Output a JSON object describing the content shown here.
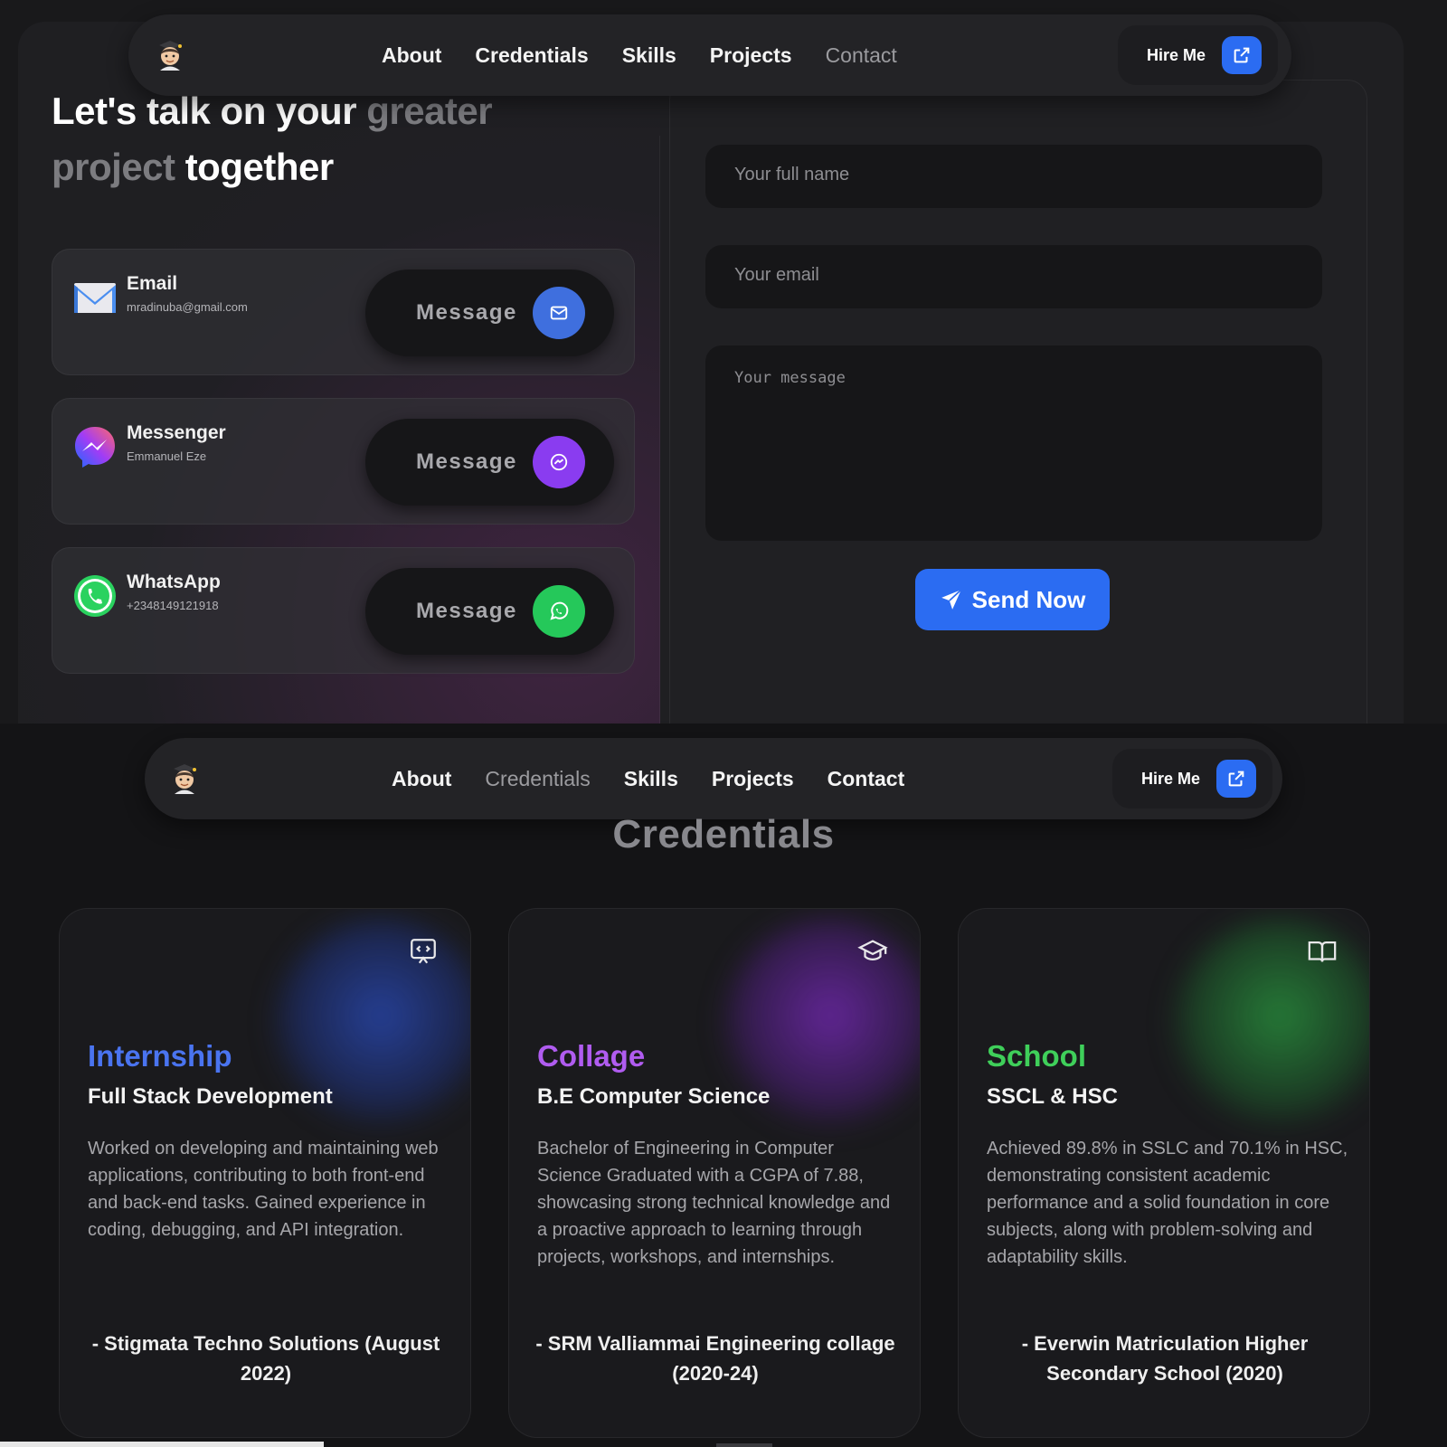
{
  "nav_top": {
    "links": [
      "About",
      "Credentials",
      "Skills",
      "Projects",
      "Contact"
    ],
    "active": "Contact",
    "hire_label": "Hire Me"
  },
  "nav_bottom": {
    "links": [
      "About",
      "Credentials",
      "Skills",
      "Projects",
      "Contact"
    ],
    "active": "Credentials",
    "hire_label": "Hire Me"
  },
  "contact": {
    "headline_part1": "Let's talk on your ",
    "headline_highlight1": "greater",
    "headline_highlight2": "project",
    "headline_part2": " together",
    "cards": [
      {
        "title": "Email",
        "subtitle": "mradinuba@gmail.com",
        "button": "Message",
        "icon": "email-icon",
        "color": "#3f6fde"
      },
      {
        "title": "Messenger",
        "subtitle": "Emmanuel Eze",
        "button": "Message",
        "icon": "messenger-icon",
        "color": "#8a3cf0"
      },
      {
        "title": "WhatsApp",
        "subtitle": "+2348149121918",
        "button": "Message",
        "icon": "whatsapp-icon",
        "color": "#25c85a"
      }
    ]
  },
  "form": {
    "name_placeholder": "Your full name",
    "email_placeholder": "Your email",
    "message_placeholder": "Your message",
    "send_label": "Send Now"
  },
  "credentials": {
    "title": "Credentials",
    "cards": [
      {
        "category": "Internship",
        "subtitle": "Full Stack Development",
        "description": "Worked on developing and maintaining web applications, contributing to both front-end and back-end tasks. Gained experience in coding, debugging, and API integration.",
        "footer": "- Stigmata Techno Solutions (August 2022)",
        "accent": "#4a74f0",
        "icon": "code-chat-icon"
      },
      {
        "category": "Collage",
        "subtitle": "B.E Computer Science",
        "description": "Bachelor of Engineering in Computer Science Graduated with a CGPA of 7.88, showcasing strong technical knowledge and a proactive approach to learning through projects, workshops, and internships.",
        "footer": "- SRM Valliammai Engineering collage (2020-24)",
        "accent": "#b05cf0",
        "icon": "graduation-cap-icon"
      },
      {
        "category": "School",
        "subtitle": "SSCL & HSC",
        "description": "Achieved 89.8% in SSLC and 70.1% in HSC, demonstrating consistent academic performance and a solid foundation in core subjects, along with problem-solving and adaptability skills.",
        "footer": "- Everwin Matriculation Higher Secondary School (2020)",
        "accent": "#3fcf5a",
        "icon": "open-book-icon"
      }
    ]
  }
}
